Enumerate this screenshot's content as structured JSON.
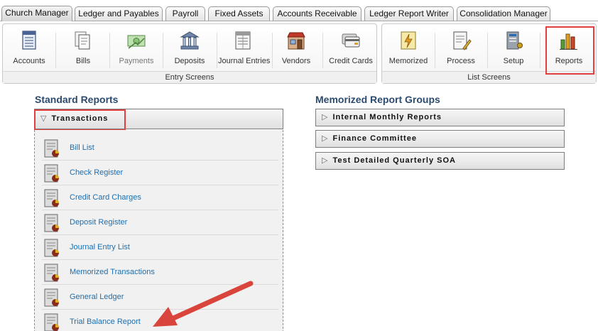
{
  "tabs": [
    {
      "label": "Church Manager",
      "active": true
    },
    {
      "label": "Ledger and Payables",
      "active": false
    },
    {
      "label": "Payroll",
      "active": false
    },
    {
      "label": "Fixed Assets",
      "active": false
    },
    {
      "label": "Accounts Receivable",
      "active": false
    },
    {
      "label": "Ledger Report Writer",
      "active": false
    },
    {
      "label": "Consolidation Manager",
      "active": false
    }
  ],
  "entry_screens": {
    "title": "Entry Screens",
    "items": [
      {
        "label": "Accounts",
        "icon": "accounts-icon"
      },
      {
        "label": "Bills",
        "icon": "bills-icon"
      },
      {
        "label": "Payments",
        "icon": "payments-icon"
      },
      {
        "label": "Deposits",
        "icon": "deposits-icon"
      },
      {
        "label": "Journal Entries",
        "icon": "journal-entries-icon"
      },
      {
        "label": "Vendors",
        "icon": "vendors-icon"
      },
      {
        "label": "Credit Cards",
        "icon": "credit-cards-icon"
      }
    ]
  },
  "list_screens": {
    "title": "List Screens",
    "items": [
      {
        "label": "Memorized",
        "icon": "memorized-icon"
      },
      {
        "label": "Process",
        "icon": "process-icon"
      },
      {
        "label": "Setup",
        "icon": "setup-icon"
      },
      {
        "label": "Reports",
        "icon": "reports-icon",
        "highlighted": true
      }
    ]
  },
  "standard_reports": {
    "title": "Standard Reports",
    "group": "Transactions",
    "items": [
      "Bill List",
      "Check Register",
      "Credit Card Charges",
      "Deposit Register",
      "Journal Entry List",
      "Memorized Transactions",
      "General Ledger",
      "Trial Balance Report"
    ]
  },
  "memorized_groups": {
    "title": "Memorized Report Groups",
    "items": [
      "Internal Monthly Reports",
      "Finance Committee",
      "Test Detailed Quarterly SOA"
    ]
  },
  "colors": {
    "highlight": "#e04040",
    "link": "#1c6fb0",
    "section_title": "#2b4a6f"
  }
}
